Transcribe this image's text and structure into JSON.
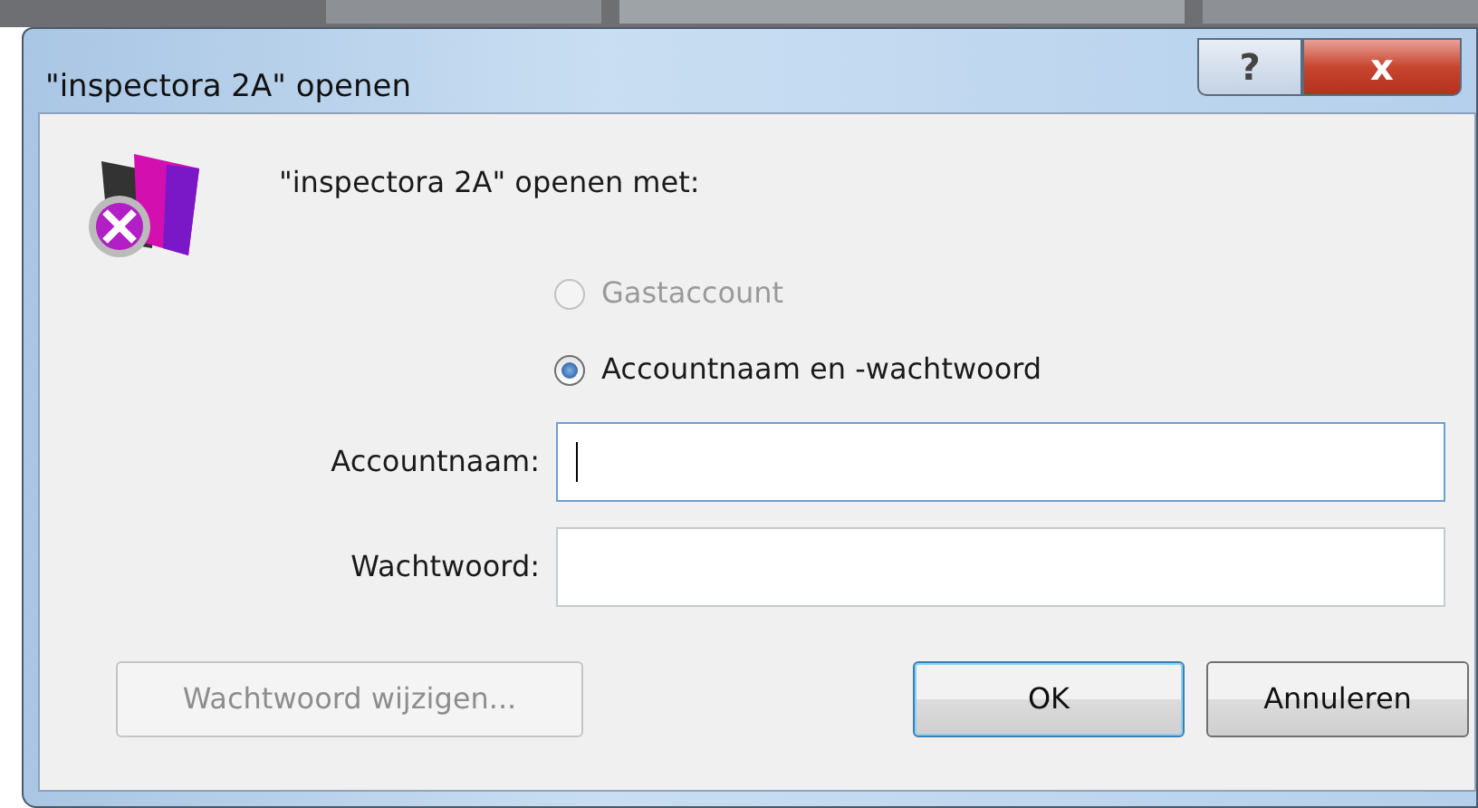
{
  "window": {
    "title": "\"inspectora 2A\" openen",
    "help_button": "?",
    "close_button": "x"
  },
  "prompt": "\"inspectora 2A\" openen met:",
  "login_options": [
    {
      "label": "Gastaccount",
      "selected": false,
      "disabled": true
    },
    {
      "label": "Accountnaam en -wachtwoord",
      "selected": true,
      "disabled": false
    }
  ],
  "fields": [
    {
      "label": "Accountnaam:",
      "focused": true
    },
    {
      "label": "Wachtwoord:",
      "focused": false
    }
  ],
  "buttons": [
    {
      "label": "Wachtwoord wijzigen...",
      "disabled": true,
      "default": false
    },
    {
      "label": "OK",
      "disabled": false,
      "default": true
    },
    {
      "label": "Annuleren",
      "disabled": false,
      "default": false
    }
  ]
}
